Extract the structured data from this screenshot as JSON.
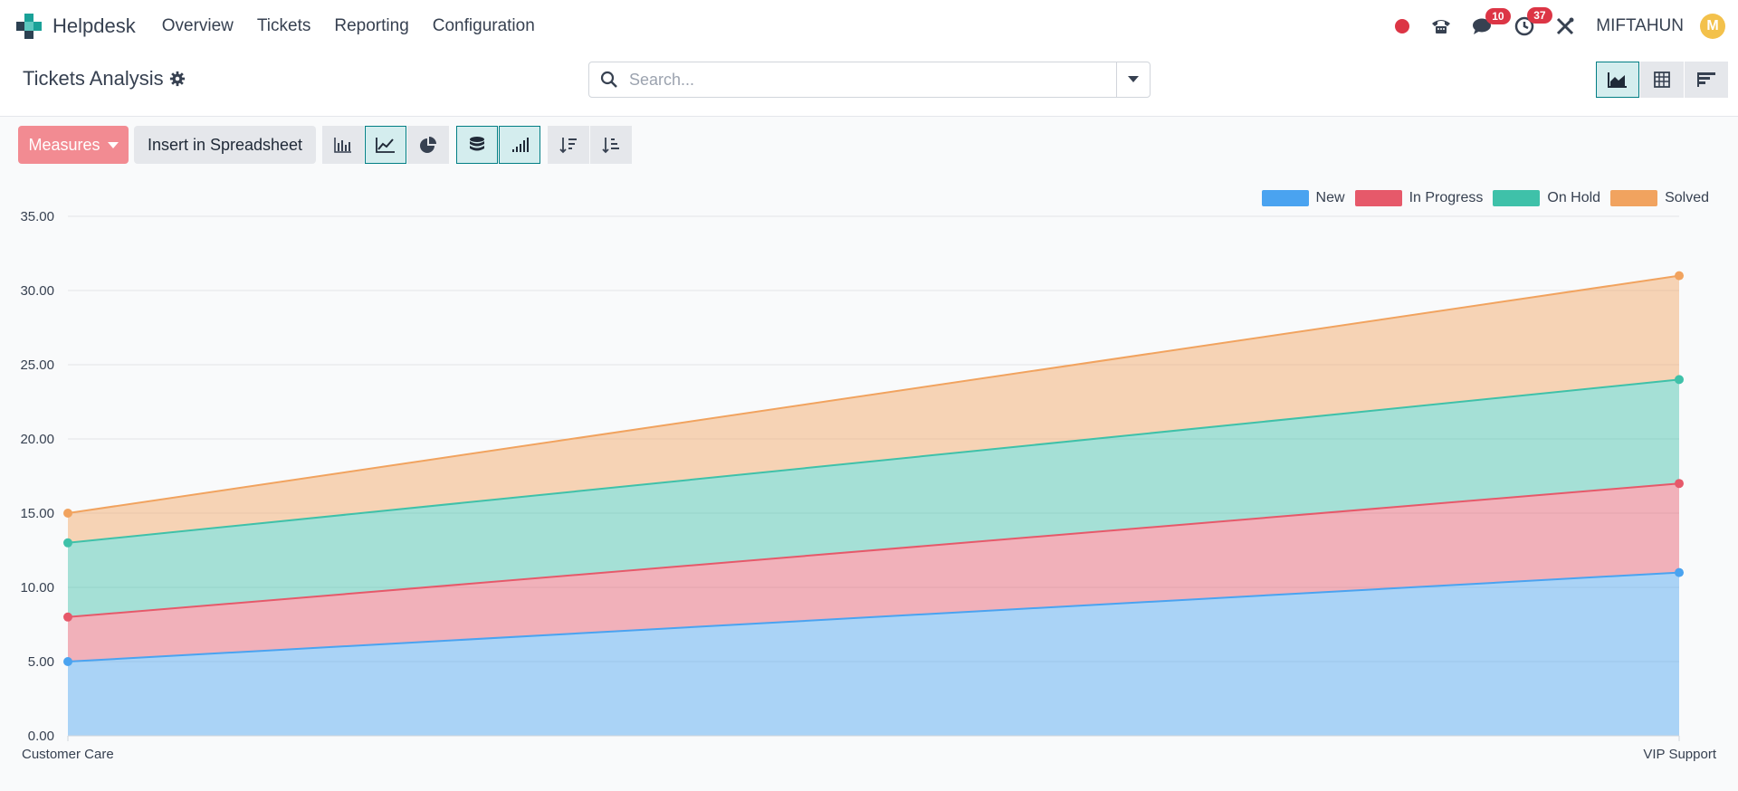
{
  "navbar": {
    "brand": "Helpdesk",
    "menu": [
      "Overview",
      "Tickets",
      "Reporting",
      "Configuration"
    ],
    "messages_count": "10",
    "activities_count": "37",
    "user_name": "MIFTAHUN",
    "avatar_letter": "M"
  },
  "control": {
    "title": "Tickets Analysis",
    "search_placeholder": "Search..."
  },
  "toolbar": {
    "measures_label": "Measures",
    "insert_label": "Insert in Spreadsheet"
  },
  "colors": {
    "new": "#4aa3f0",
    "in_progress": "#e6596a",
    "on_hold": "#3fc1a9",
    "solved": "#f1a35f",
    "accent": "#017e84"
  },
  "chart_data": {
    "type": "area",
    "stacked": true,
    "categories": [
      "Customer Care",
      "VIP Support"
    ],
    "ylim": [
      0,
      35
    ],
    "y_ticks": [
      "0.00",
      "5.00",
      "10.00",
      "15.00",
      "20.00",
      "25.00",
      "30.00",
      "35.00"
    ],
    "legend_position": "top-right",
    "grid": true,
    "series": [
      {
        "name": "New",
        "values": [
          5,
          11
        ]
      },
      {
        "name": "In Progress",
        "values": [
          3,
          6
        ]
      },
      {
        "name": "On Hold",
        "values": [
          5,
          7
        ]
      },
      {
        "name": "Solved",
        "values": [
          2,
          7
        ]
      }
    ]
  }
}
